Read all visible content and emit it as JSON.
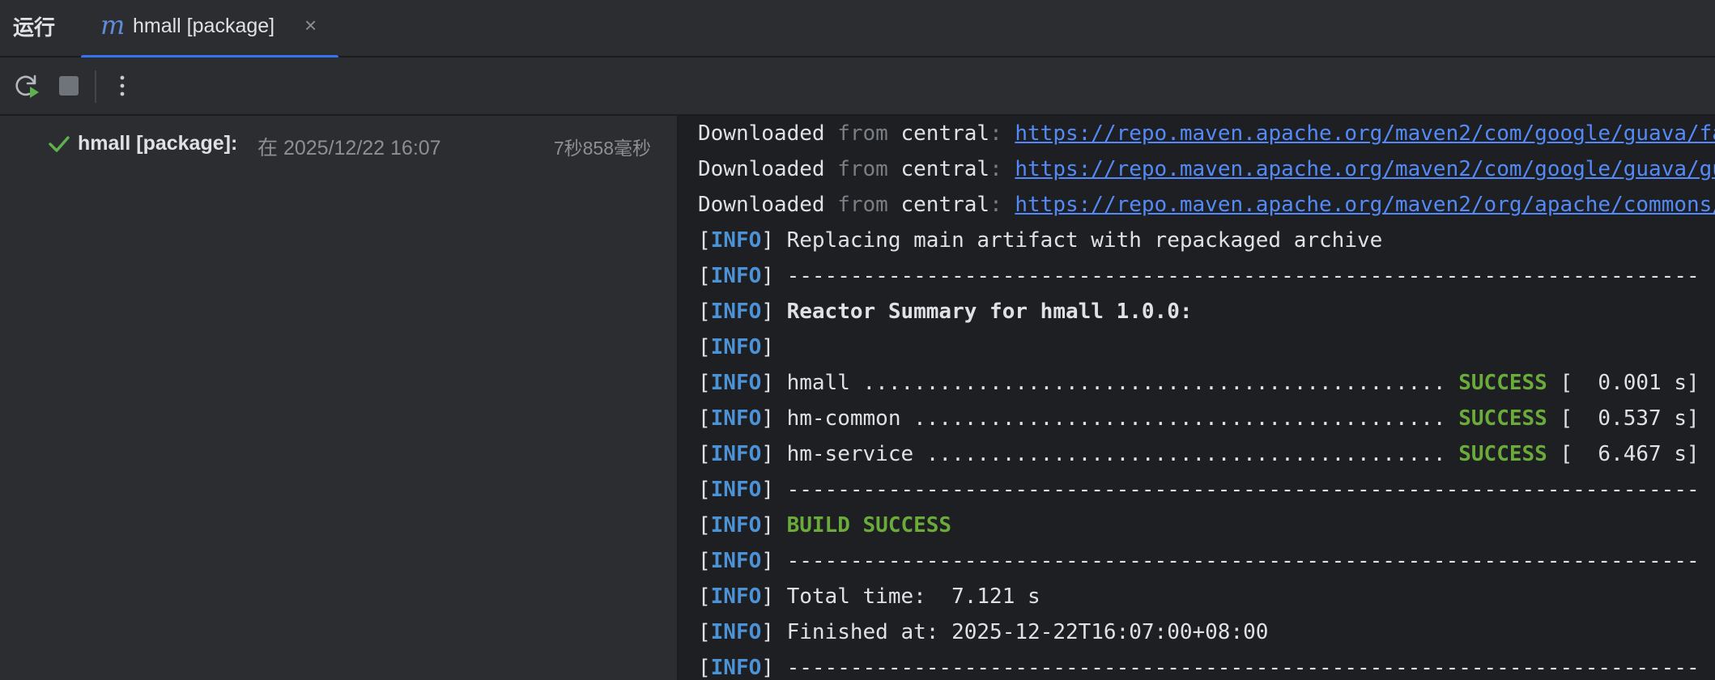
{
  "tabbar": {
    "run_label": "运行",
    "tab_icon": "m",
    "tab_title": "hmall [package]",
    "close_symbol": "×",
    "accent": "#3574f0"
  },
  "toolbar": {
    "icons": [
      "rerun-icon",
      "stop-icon",
      "more-icon"
    ]
  },
  "tree": {
    "item": {
      "name": "hmall [package]:",
      "time": "在 2025/12/22 16:07",
      "duration": "7秒858毫秒",
      "status_icon": "check-icon",
      "status_color": "#5fb04e"
    }
  },
  "console": {
    "downloads": [
      {
        "prefix": "Downloaded",
        "from": "from",
        "repo": "central",
        "url": "https://repo.maven.apache.org/maven2/com/google/guava/fa"
      },
      {
        "prefix": "Downloaded",
        "from": "from",
        "repo": "central",
        "url": "https://repo.maven.apache.org/maven2/com/google/guava/gu"
      },
      {
        "prefix": "Downloaded",
        "from": "from",
        "repo": "central",
        "url": "https://repo.maven.apache.org/maven2/org/apache/commons/"
      }
    ],
    "info_tag": "INFO",
    "lines": {
      "replacing": "Replacing main artifact with repackaged archive",
      "separator": "------------------------------------------------------------------------",
      "reactor": "Reactor Summary for hmall 1.0.0:",
      "empty": "",
      "build_success": "BUILD SUCCESS",
      "total_time": "Total time:  7.121 s",
      "finished_at": "Finished at: 2025-12-22T16:07:00+08:00"
    },
    "modules": [
      {
        "name": "hmall ..............................................",
        "status": "SUCCESS",
        "time": "[  0.001 s]"
      },
      {
        "name": "hm-common ..........................................",
        "status": "SUCCESS",
        "time": "[  0.537 s]"
      },
      {
        "name": "hm-service .........................................",
        "status": "SUCCESS",
        "time": "[  6.467 s]"
      }
    ],
    "colors": {
      "info": "#4c92d6",
      "success": "#6aab3a",
      "link": "#548af7"
    }
  }
}
